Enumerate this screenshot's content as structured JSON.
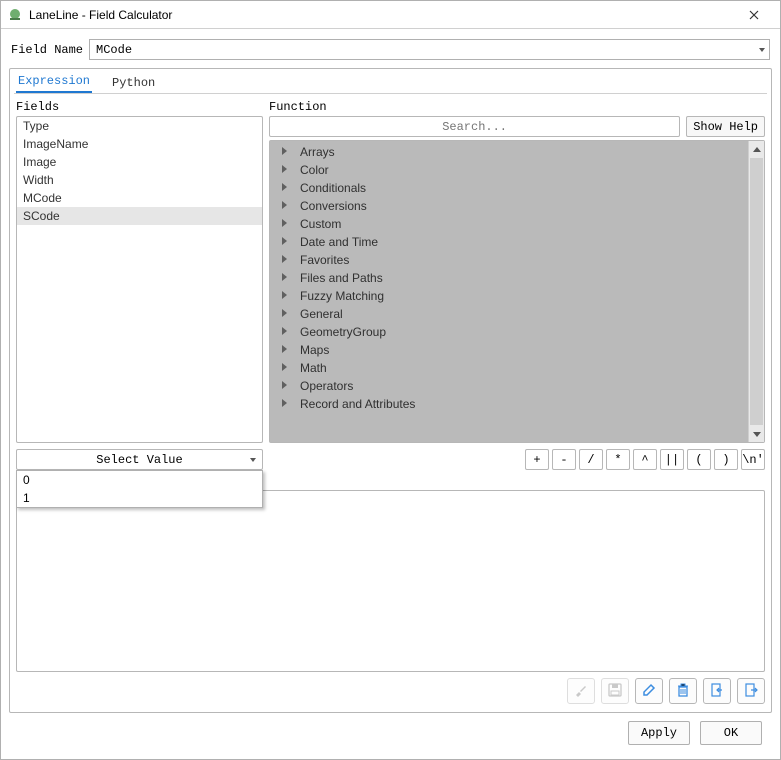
{
  "window": {
    "title": "LaneLine - Field Calculator"
  },
  "field_name": {
    "label": "Field Name",
    "value": "MCode"
  },
  "tabs": {
    "expression": "Expression",
    "python": "Python",
    "active": "expression"
  },
  "sections": {
    "fields_label": "Fields",
    "function_label": "Function"
  },
  "fields": {
    "items": [
      "Type",
      "ImageName",
      "Image",
      "Width",
      "MCode",
      "SCode"
    ],
    "selected_index": 5
  },
  "function": {
    "search_placeholder": "Search...",
    "show_help": "Show Help",
    "categories": [
      "Arrays",
      "Color",
      "Conditionals",
      "Conversions",
      "Custom",
      "Date and Time",
      "Favorites",
      "Files and Paths",
      "Fuzzy Matching",
      "General",
      "GeometryGroup",
      "Maps",
      "Math",
      "Operators",
      "Record and Attributes"
    ]
  },
  "select_value": {
    "label": "Select Value",
    "options": [
      "0",
      "1"
    ]
  },
  "operators": [
    "+",
    "-",
    "/",
    "*",
    "^",
    "||",
    "(",
    ")",
    "\\n'"
  ],
  "expression_label": "=",
  "toolbar_icons": [
    "brush-icon",
    "save-icon",
    "edit-icon",
    "delete-icon",
    "import-icon",
    "export-icon"
  ],
  "toolbar_disabled": [
    true,
    true,
    false,
    false,
    false,
    false
  ],
  "footer": {
    "apply": "Apply",
    "ok": "OK"
  },
  "colors": {
    "accent": "#1f78d1",
    "tree_bg": "#bababa",
    "icon_blue": "#3d8de0"
  }
}
